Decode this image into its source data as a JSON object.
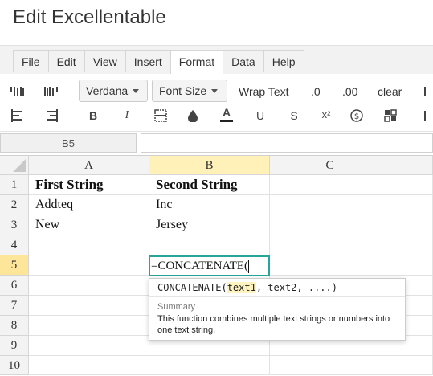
{
  "app": {
    "title": "Edit Excellentable"
  },
  "menu": {
    "tabs": [
      "File",
      "Edit",
      "View",
      "Insert",
      "Format",
      "Data",
      "Help"
    ],
    "active": "Format"
  },
  "toolbar": {
    "font_family": "Verdana",
    "font_size": "Font Size",
    "wrap_text": "Wrap Text",
    "dec_less": ".0",
    "dec_more": ".00",
    "clear": "clear",
    "bold": "B",
    "italic": "I",
    "text_color": "A",
    "underline": "U",
    "strike": "S",
    "superscript": "x²"
  },
  "formula_bar": {
    "cell_ref": "B5",
    "content": ""
  },
  "sheet": {
    "columns": [
      "A",
      "B",
      "C"
    ],
    "rows": [
      "1",
      "2",
      "3",
      "4",
      "5",
      "6",
      "7",
      "8",
      "9",
      "10"
    ],
    "cells": {
      "A1": "First String",
      "B1": "Second String",
      "A2": "Addteq",
      "B2": "Inc",
      "A3": "New",
      "B3": "Jersey"
    },
    "editing": {
      "cell": "B5",
      "text": "=CONCATENATE("
    }
  },
  "autocomplete": {
    "fn": "CONCATENATE(",
    "arg_active": "text1",
    "rest": ", text2, ....)",
    "summary_label": "Summary",
    "summary_text": "This function combines multiple text strings or numbers into one text string."
  },
  "colors": {
    "accent": "#26a69a",
    "selected_header": "#fde59a",
    "selected_col_header": "#fff1b8"
  }
}
